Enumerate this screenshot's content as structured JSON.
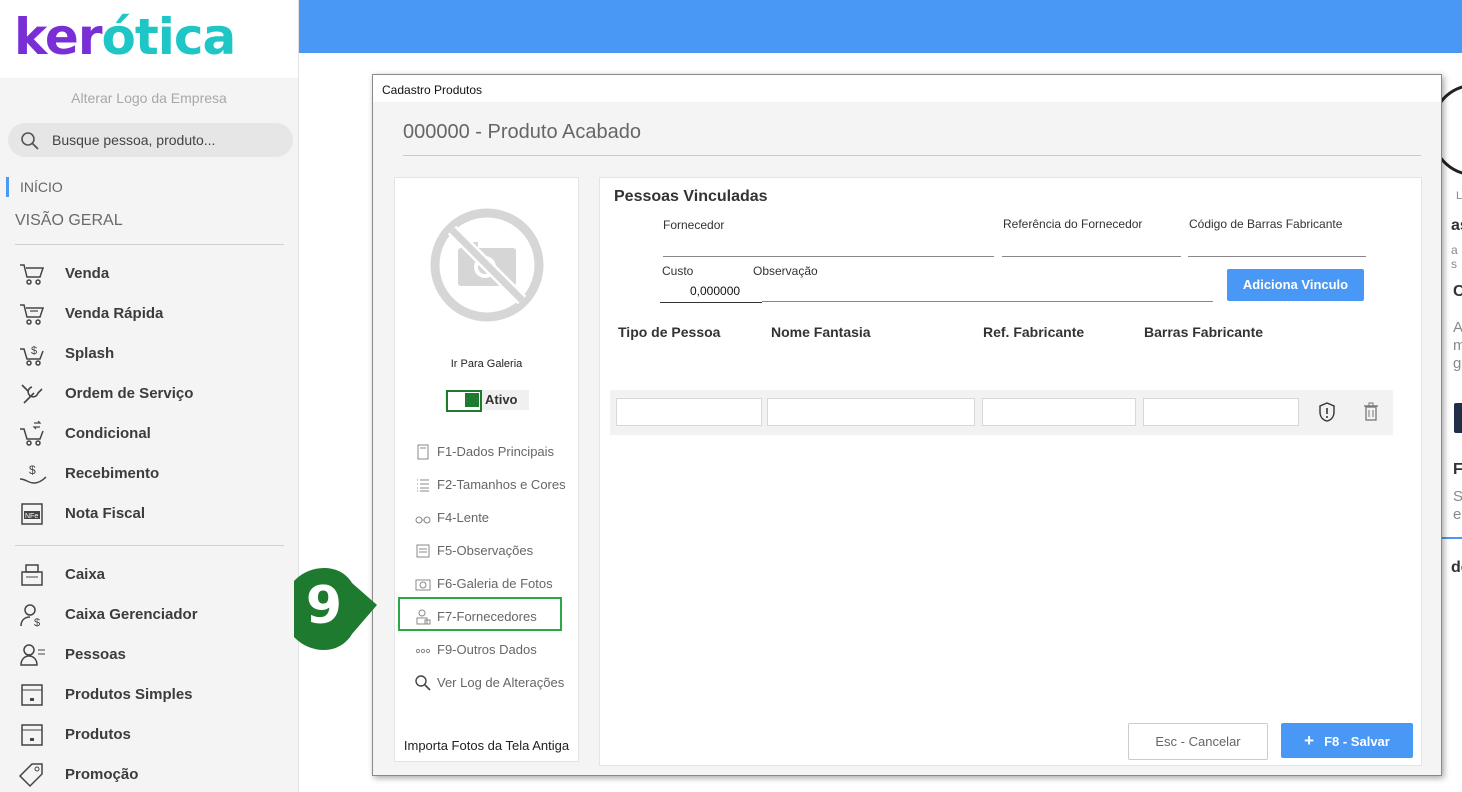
{
  "sidebar": {
    "logo_part1": "ker",
    "logo_part2": "ótica",
    "alter_logo": "Alterar Logo da Empresa",
    "search_placeholder": "Busque pessoa, produto...",
    "inicio": "INÍCIO",
    "visao_geral": "VISÃO GERAL",
    "items_group1": [
      {
        "label": "Venda",
        "icon": "cart-icon"
      },
      {
        "label": "Venda Rápida",
        "icon": "cart-fast-icon"
      },
      {
        "label": "Splash",
        "icon": "cart-dollar-icon"
      },
      {
        "label": "Ordem de Serviço",
        "icon": "wrench-icon"
      },
      {
        "label": "Condicional",
        "icon": "cart-arrows-icon"
      },
      {
        "label": "Recebimento",
        "icon": "hand-dollar-icon"
      },
      {
        "label": "Nota Fiscal",
        "icon": "nfe-icon"
      }
    ],
    "items_group2": [
      {
        "label": "Caixa",
        "icon": "cash-register-icon"
      },
      {
        "label": "Caixa Gerenciador",
        "icon": "person-dollar-icon"
      },
      {
        "label": "Pessoas",
        "icon": "people-icon"
      },
      {
        "label": "Produtos Simples",
        "icon": "box-icon"
      },
      {
        "label": "Produtos",
        "icon": "box-icon"
      },
      {
        "label": "Promoção",
        "icon": "tag-icon"
      }
    ]
  },
  "background": {
    "text_as": "as",
    "text_a_s": "a s",
    "text_c": "C",
    "text_a": "A",
    "text_m": "m",
    "text_g": "g",
    "text_f": "F",
    "text_s": "S",
    "text_e": "e",
    "text_de": "de",
    "text_l": "L"
  },
  "modal": {
    "window_title": "Cadastro Produtos",
    "product_title": "000000 - Produto Acabado",
    "left": {
      "ir_galeria": "Ir Para Galeria",
      "status_label": "Ativo",
      "menu": [
        {
          "label": "F1-Dados Principais",
          "icon": "document-icon"
        },
        {
          "label": "F2-Tamanhos  e Cores",
          "icon": "list-icon"
        },
        {
          "label": "F4-Lente",
          "icon": "glasses-icon"
        },
        {
          "label": "F5-Observações",
          "icon": "notes-icon"
        },
        {
          "label": "F6-Galeria de Fotos",
          "icon": "camera-icon"
        },
        {
          "label": "F7-Fornecedores",
          "icon": "supplier-icon"
        },
        {
          "label": "F9-Outros Dados",
          "icon": "dots-icon"
        },
        {
          "label": "Ver Log de Alterações",
          "icon": "magnifier-icon"
        }
      ],
      "importa": "Importa Fotos da Tela Antiga"
    },
    "right": {
      "section_title": "Pessoas Vinculadas",
      "fornecedor_label": "Fornecedor",
      "referencia_label": "Referência do Fornecedor",
      "codigo_barras_label": "Código de Barras Fabricante",
      "custo_label": "Custo",
      "custo_value": "0,000000",
      "observacao_label": "Observação",
      "adiciona_button": "Adiciona Vinculo",
      "columns": [
        "Tipo de Pessoa",
        "Nome Fantasia",
        "Ref. Fabricante",
        "Barras Fabricante"
      ],
      "cancel_button": "Esc - Cancelar",
      "save_button": "F8 - Salvar",
      "save_icon": "plus-icon"
    }
  },
  "annotation": {
    "step_number": "9",
    "highlight_color": "#2aa845",
    "badge_color": "#1e7a2e"
  },
  "colors": {
    "accent_blue": "#4a98f5",
    "logo_purple": "#7a2fd6",
    "logo_teal": "#1ec6c6"
  }
}
